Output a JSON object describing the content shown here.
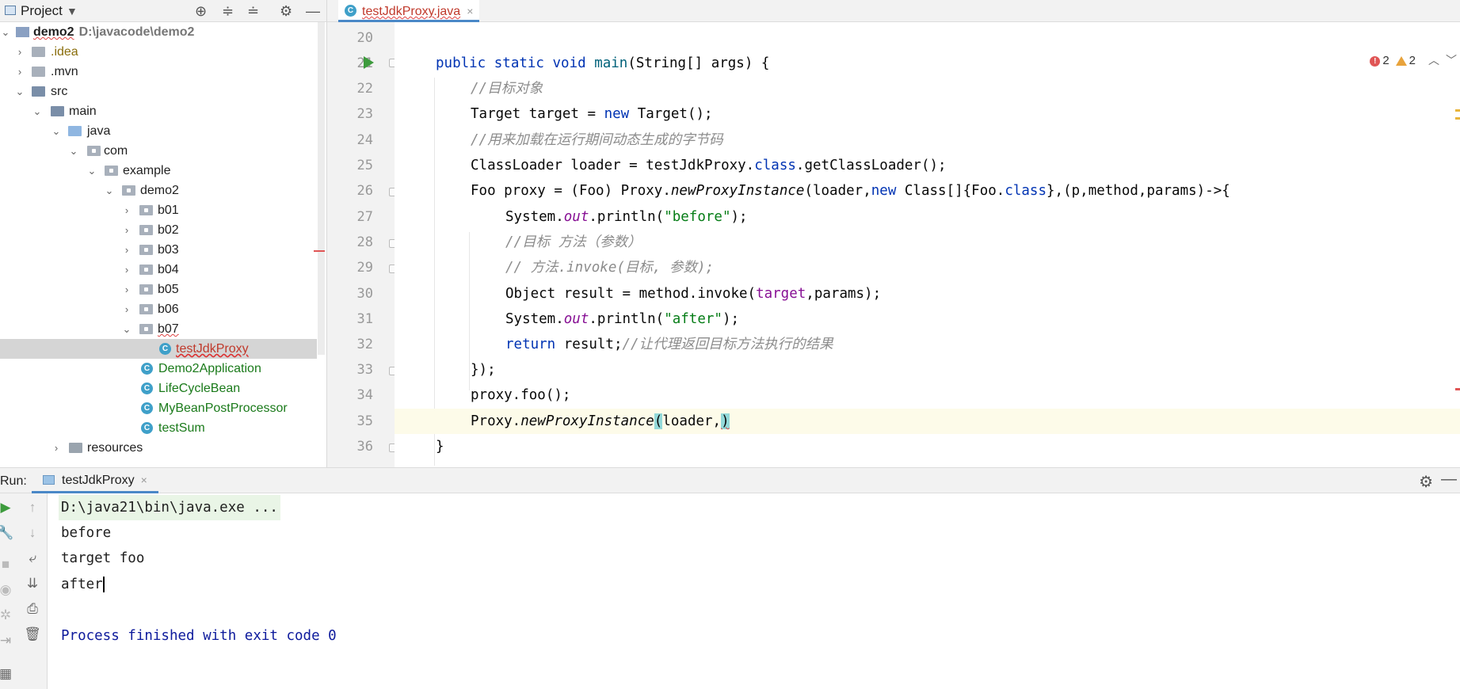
{
  "project_panel": {
    "title": "Project",
    "tree": [
      {
        "label": "demo2",
        "path": "D:\\javacode\\demo2"
      },
      {
        "label": ".idea"
      },
      {
        "label": ".mvn"
      },
      {
        "label": "src"
      },
      {
        "label": "main"
      },
      {
        "label": "java"
      },
      {
        "label": "com"
      },
      {
        "label": "example"
      },
      {
        "label": "demo2"
      },
      {
        "label": "b01"
      },
      {
        "label": "b02"
      },
      {
        "label": "b03"
      },
      {
        "label": "b04"
      },
      {
        "label": "b05"
      },
      {
        "label": "b06"
      },
      {
        "label": "b07"
      },
      {
        "label": "testJdkProxy"
      },
      {
        "label": "Demo2Application"
      },
      {
        "label": "LifeCycleBean"
      },
      {
        "label": "MyBeanPostProcessor"
      },
      {
        "label": "testSum"
      },
      {
        "label": "resources"
      }
    ]
  },
  "editor": {
    "tab_label": "testJdkProxy.java",
    "tab_close": "×",
    "inspections": {
      "errors": "2",
      "warnings": "2"
    },
    "line_numbers": [
      "20",
      "21",
      "22",
      "23",
      "24",
      "25",
      "26",
      "27",
      "28",
      "29",
      "30",
      "31",
      "32",
      "33",
      "34",
      "35",
      "36"
    ],
    "code": {
      "l21_kw": "public static void ",
      "l21_method": "main",
      "l21_rest": "(String[] args) {",
      "l22_comment": "//目标对象",
      "l23_a": "Target target = ",
      "l23_kw": "new",
      "l23_b": " Target();",
      "l24_comment": "//用来加载在运行期间动态生成的字节码",
      "l25_a": "ClassLoader loader = testJdkProxy.",
      "l25_kw": "class",
      "l25_b": ".getClassLoader();",
      "l26_a": "Foo proxy = (Foo) Proxy.",
      "l26_m": "newProxyInstance",
      "l26_b": "(loader,",
      "l26_kw": "new",
      "l26_c": " Class[]{Foo.",
      "l26_kw2": "class",
      "l26_d": "},(p,method,params)->{",
      "l27_a": "System.",
      "l27_f": "out",
      "l27_b": ".println(",
      "l27_s": "\"before\"",
      "l27_c": ");",
      "l28_comment": "//目标 方法（参数）",
      "l29_comment": "// 方法.invoke(目标, 参数);",
      "l30_a": "Object result = method.invoke(",
      "l30_p": "target",
      "l30_b": ",params);",
      "l31_a": "System.",
      "l31_f": "out",
      "l31_b": ".println(",
      "l31_s": "\"after\"",
      "l31_c": ");",
      "l32_kw": "return",
      "l32_a": " result;",
      "l32_comment": "//让代理返回目标方法执行的结果",
      "l33": "});",
      "l34": "proxy.foo();",
      "l35_a": "Proxy.",
      "l35_m": "newProxyInstance",
      "l35_open": "(",
      "l35_b": "loader,",
      "l35_close": ")",
      "l36": "}"
    }
  },
  "run_panel": {
    "label": "Run:",
    "tab_label": "testJdkProxy",
    "tab_close": "×",
    "console": {
      "command": "D:\\java21\\bin\\java.exe ...",
      "lines": [
        "before",
        "target foo",
        "after"
      ],
      "exit": "Process finished with exit code 0"
    }
  }
}
